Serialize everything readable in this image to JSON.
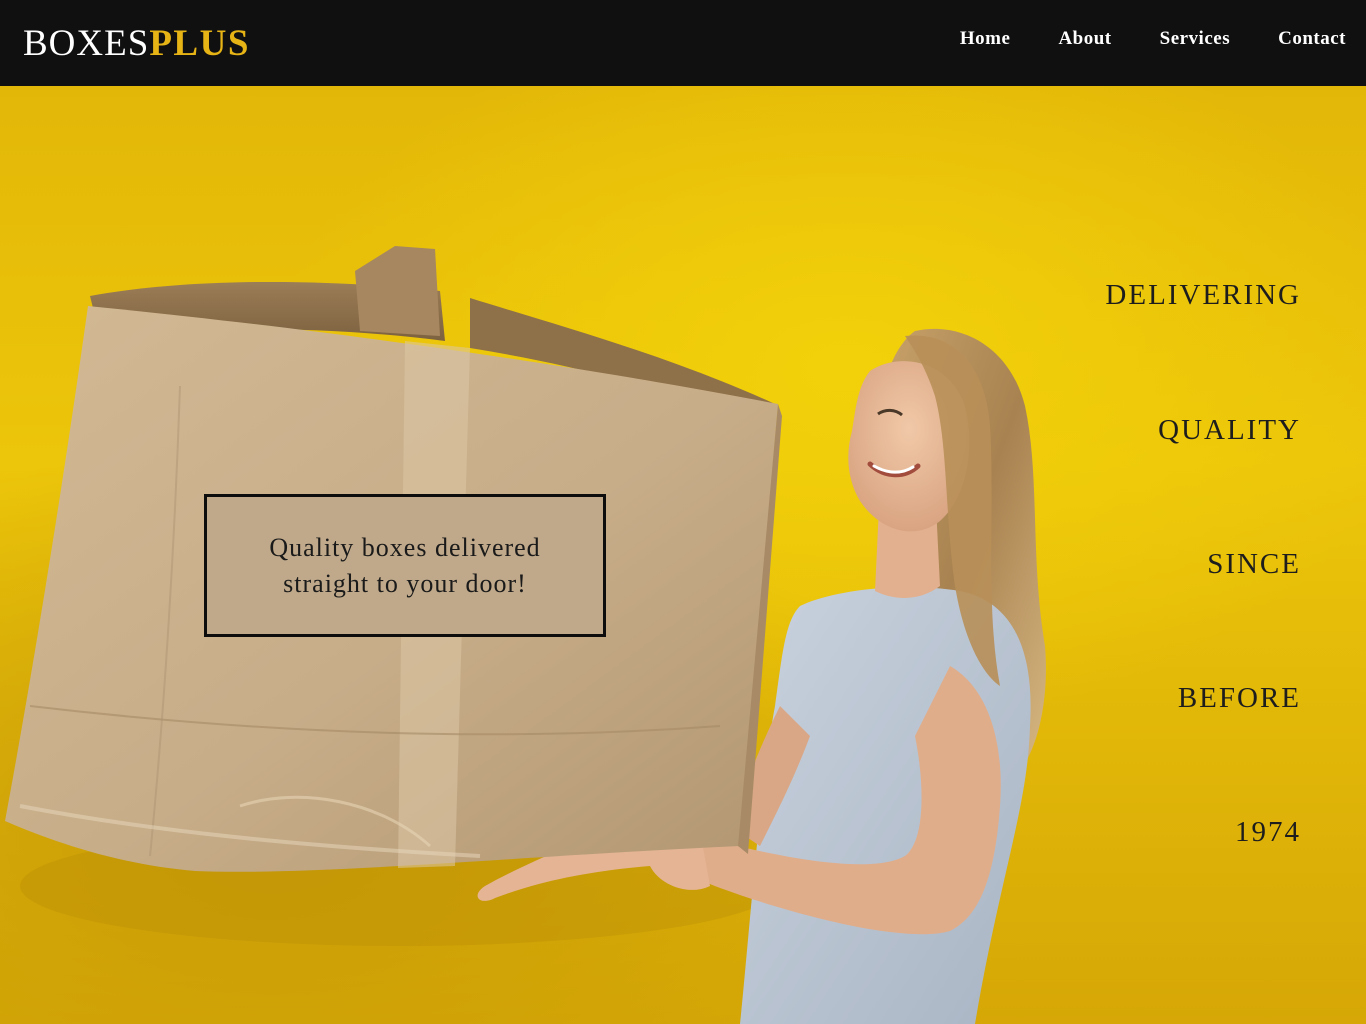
{
  "brand": {
    "part_one": "BOXES",
    "part_two": "PLUS",
    "accent_color": "#e7b416"
  },
  "nav": {
    "items": [
      {
        "label": "Home"
      },
      {
        "label": "About"
      },
      {
        "label": "Services"
      },
      {
        "label": "Contact"
      }
    ]
  },
  "hero": {
    "caption": "Quality boxes delivered straight to your door!",
    "tagline_words": [
      "DELIVERING",
      "QUALITY",
      "SINCE",
      "BEFORE",
      "1974"
    ],
    "background_color": "#e8bf08",
    "box_color": "#c8ae8a"
  }
}
